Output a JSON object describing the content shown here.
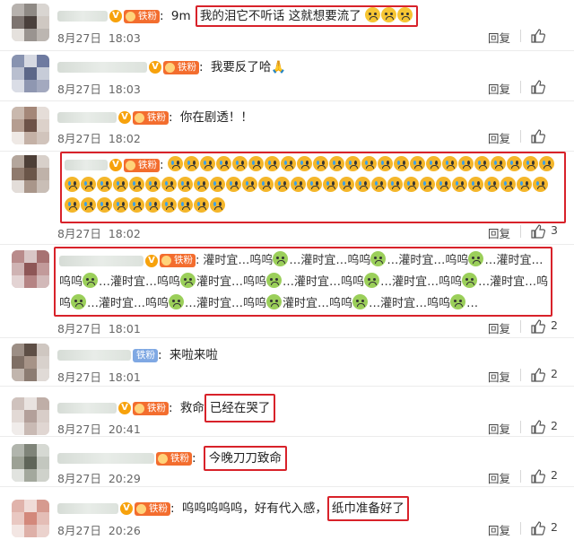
{
  "reply_label": "回复",
  "colors": {
    "highlight": "#d8222a",
    "fan_badge": "#f36d2e",
    "blue_badge": "#7fa8e3"
  },
  "badges": {
    "fan": "铁粉",
    "v": "V"
  },
  "comments": [
    {
      "text_prefix": "9m",
      "text": "我的泪它不听话 这就想要流了",
      "date": "8月27日",
      "time": "18:03",
      "likes": ""
    },
    {
      "text": "我要反了哈🙏",
      "date": "8月27日",
      "time": "18:03",
      "likes": ""
    },
    {
      "text": "你在剧透！！",
      "date": "8月27日",
      "time": "18:02",
      "likes": ""
    },
    {
      "text": "",
      "date": "8月27日",
      "time": "18:02",
      "likes": "3"
    },
    {
      "text": "灌时宜…呜呜",
      "date": "8月27日",
      "time": "18:01",
      "likes": "2"
    },
    {
      "text": "来啦来啦",
      "date": "8月27日",
      "time": "18:01",
      "likes": "2"
    },
    {
      "text_prefix": "救命",
      "text": "已经在哭了",
      "date": "8月27日",
      "time": "20:41",
      "likes": "2"
    },
    {
      "text": "今晚刀刀致命",
      "date": "8月27日",
      "time": "20:29",
      "likes": "2"
    },
    {
      "text_prefix": "呜呜呜呜呜，好有代入感，",
      "text": "纸巾准备好了",
      "date": "8月27日",
      "time": "20:26",
      "likes": "2"
    }
  ],
  "repeat_snippet": {
    "a": "灌时宜…呜呜",
    "b": "…灌时宜…呜呜",
    "c": "灌时宜…呜呜",
    "d": "…"
  }
}
